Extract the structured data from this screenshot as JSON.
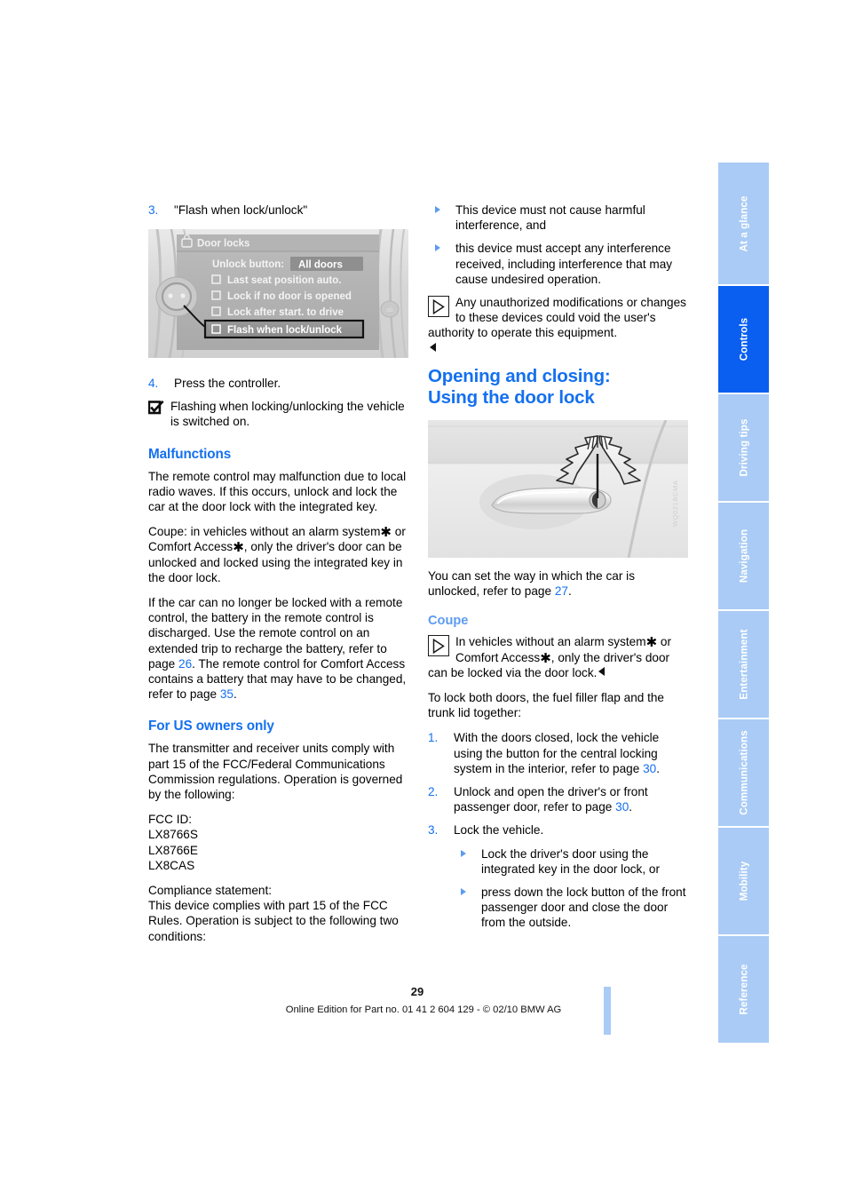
{
  "document": {
    "page_number": "29",
    "footer": "Online Edition for Part no. 01 41 2 604 129 - © 02/10 BMW AG"
  },
  "tabs": [
    {
      "label": "At a glance",
      "active": false
    },
    {
      "label": "Controls",
      "active": true
    },
    {
      "label": "Driving tips",
      "active": false
    },
    {
      "label": "Navigation",
      "active": false
    },
    {
      "label": "Entertainment",
      "active": false
    },
    {
      "label": "Communications",
      "active": false
    },
    {
      "label": "Mobility",
      "active": false
    },
    {
      "label": "Reference",
      "active": false
    }
  ],
  "left_column": {
    "step3": {
      "num": "3.",
      "text": "\"Flash when lock/unlock\""
    },
    "idrive_figure": {
      "title": "Door locks",
      "rows": [
        {
          "label": "Unlock button:",
          "value": "All doors"
        },
        {
          "label": "Last seat position auto.",
          "checked": false
        },
        {
          "label": "Lock if no door is opened",
          "checked": false
        },
        {
          "label": "Lock after start. to drive",
          "checked": false
        },
        {
          "label": "Flash when lock/unlock",
          "checked": false,
          "highlighted": true
        }
      ]
    },
    "step4": {
      "num": "4.",
      "text": "Press the controller."
    },
    "checkbox_note": "Flashing when locking/unlocking the vehicle is switched on.",
    "malfunctions": {
      "heading": "Malfunctions",
      "p1": "The remote control may malfunction due to local radio waves. If this occurs, unlock and lock the car at the door lock with the integrated key.",
      "p2_a": "Coupe: in vehicles without an alarm system",
      "p2_b": " or Comfort Access",
      "p2_c": ", only the driver's door can be unlocked and locked using the integrated key in the door lock.",
      "p3_a": "If the car can no longer be locked with a remote control, the battery in the remote control is discharged. Use the remote control on an extended trip to recharge the battery, refer to page ",
      "p3_ref1": "26",
      "p3_b": ". The remote control for Comfort Access contains a battery that may have to be changed, refer to page ",
      "p3_ref2": "35",
      "p3_c": "."
    },
    "us_owners": {
      "heading": "For US owners only",
      "p1": "The transmitter and receiver units comply with part 15 of the FCC/Federal Communications Commission regulations. Operation is governed by the following:",
      "fcc_label": "FCC ID:",
      "fcc_ids": [
        "LX8766S",
        "LX8766E",
        "LX8CAS"
      ],
      "compliance_label": "Compliance statement:",
      "compliance_text": "This device complies with part 15 of the FCC Rules. Operation is subject to the following two conditions:"
    }
  },
  "right_column": {
    "bullets": [
      "This device must not cause harmful interference, and",
      "this device must accept any interference received, including interference that may cause undesired operation."
    ],
    "warning_note": "Any unauthorized modifications or changes to these devices could void the user's authority to operate this equipment.",
    "title": "Opening and closing: Using the door lock",
    "title_line1": "Opening and closing:",
    "title_line2": "Using the door lock",
    "door_figure_id": "WQ021BCMA",
    "intro_a": "You can set the way in which the car is unlocked, refer to page ",
    "intro_ref": "27",
    "intro_b": ".",
    "coupe": {
      "heading": "Coupe",
      "note_a": "In vehicles without an alarm system",
      "note_b": " or Comfort Access",
      "note_c": ", only the driver's door can be locked via the door lock.",
      "lead": "To lock both doors, the fuel filler flap and the trunk lid together:",
      "steps": [
        {
          "num": "1.",
          "text_a": "With the doors closed, lock the vehicle using the button for the central locking system in the interior, refer to page ",
          "ref": "30",
          "text_b": "."
        },
        {
          "num": "2.",
          "text_a": "Unlock and open the driver's or front passenger door, refer to page ",
          "ref": "30",
          "text_b": "."
        },
        {
          "num": "3.",
          "text_a": "Lock the vehicle.",
          "ref": "",
          "text_b": ""
        }
      ],
      "sub_bullets": [
        "Lock the driver's door using the integrated key in the door lock, or",
        "press down the lock button of the front passenger door and close the door from the outside."
      ]
    }
  },
  "colors": {
    "heading_blue": "#1470ef",
    "sub_blue": "#5c9bef",
    "tab_inactive": "#a9cbf5",
    "tab_active": "#0a5ff0"
  }
}
